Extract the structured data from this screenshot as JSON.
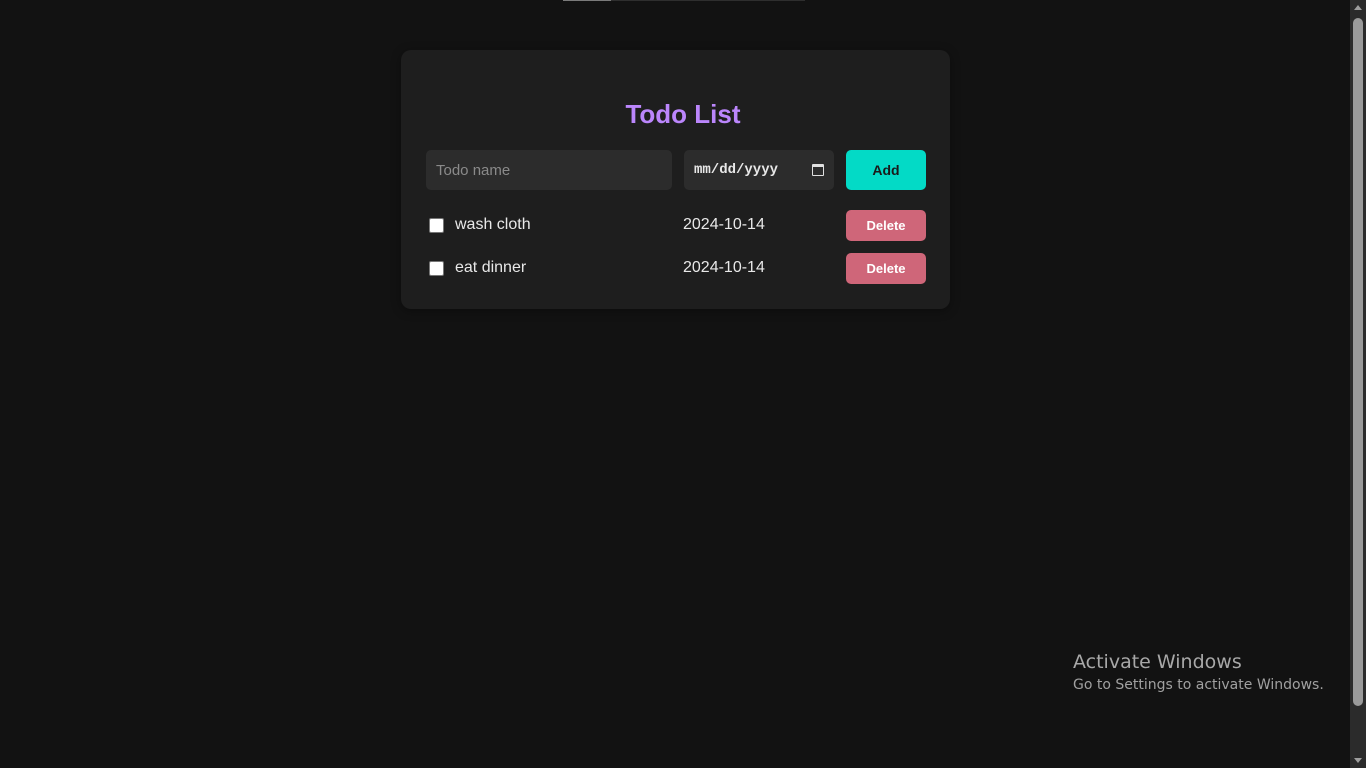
{
  "app": {
    "title": "Todo List",
    "accent_color": "#bb86fc"
  },
  "form": {
    "name_placeholder": "Todo name",
    "name_value": "",
    "date_placeholder": "mm/dd/yyyy",
    "date_icon": "calendar-icon",
    "add_label": "Add",
    "add_color": "#03dac6"
  },
  "todos": [
    {
      "name": "wash cloth",
      "date": "2024-10-14",
      "checked": false,
      "delete_label": "Delete"
    },
    {
      "name": "eat dinner",
      "date": "2024-10-14",
      "checked": false,
      "delete_label": "Delete"
    }
  ],
  "delete_color": "#cf6679",
  "watermark": {
    "title": "Activate Windows",
    "subtitle": "Go to Settings to activate Windows."
  }
}
